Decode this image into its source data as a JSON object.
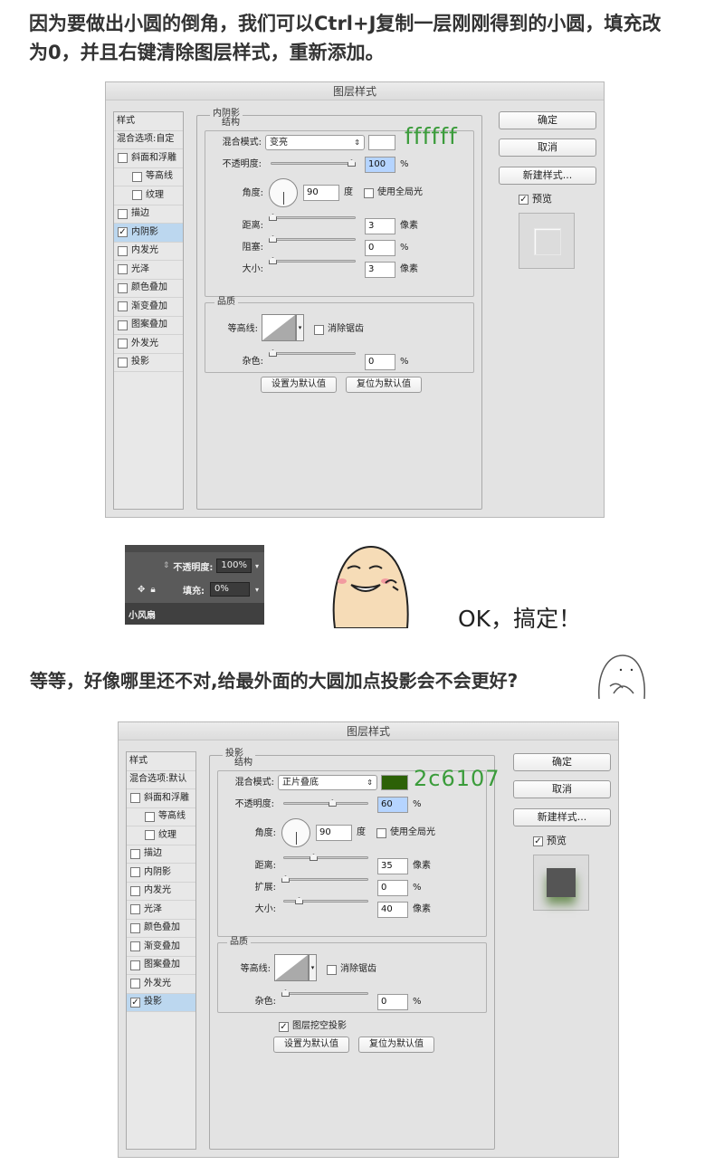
{
  "intro": {
    "line1": "因为要做出小圆的倒角，我们可以Ctrl+J复制一层刚刚得到的小圆，填充改",
    "line2": "为0，并且右键清除图层样式，重新添加。"
  },
  "dialog1": {
    "title": "图层样式",
    "sidebar": {
      "style_header": "样式",
      "blend_options": "混合选项:自定",
      "items": [
        {
          "label": "斜面和浮雕",
          "checked": false,
          "indent": false,
          "active": false
        },
        {
          "label": "等高线",
          "checked": false,
          "indent": true,
          "active": false
        },
        {
          "label": "纹理",
          "checked": false,
          "indent": true,
          "active": false
        },
        {
          "label": "描边",
          "checked": false,
          "indent": false,
          "active": false
        },
        {
          "label": "内阴影",
          "checked": true,
          "indent": false,
          "active": true
        },
        {
          "label": "内发光",
          "checked": false,
          "indent": false,
          "active": false
        },
        {
          "label": "光泽",
          "checked": false,
          "indent": false,
          "active": false
        },
        {
          "label": "颜色叠加",
          "checked": false,
          "indent": false,
          "active": false
        },
        {
          "label": "渐变叠加",
          "checked": false,
          "indent": false,
          "active": false
        },
        {
          "label": "图案叠加",
          "checked": false,
          "indent": false,
          "active": false
        },
        {
          "label": "外发光",
          "checked": false,
          "indent": false,
          "active": false
        },
        {
          "label": "投影",
          "checked": false,
          "indent": false,
          "active": false
        }
      ]
    },
    "section_title": "内阴影",
    "structure_label": "结构",
    "blend_mode_label": "混合模式:",
    "blend_mode_value": "变亮",
    "color_swatch": "#ffffff",
    "color_note": "ffffff",
    "opacity_label": "不透明度:",
    "opacity_value": "100",
    "opacity_pct": 1.0,
    "percent": "%",
    "angle_label": "角度:",
    "angle_value": "90",
    "degree": "度",
    "global_light_label": "使用全局光",
    "distance_label": "距离:",
    "distance_value": "3",
    "choke_label": "阻塞:",
    "choke_value": "0",
    "size_label": "大小:",
    "size_value": "3",
    "pixels": "像素",
    "quality_label": "品质",
    "contour_label": "等高线:",
    "antialias_label": "消除锯齿",
    "noise_label": "杂色:",
    "noise_value": "0",
    "default_btn": "设置为默认值",
    "reset_btn": "复位为默认值",
    "ok_btn": "确定",
    "cancel_btn": "取消",
    "new_style_btn": "新建样式...",
    "preview_label": "预览",
    "preview_checked": true
  },
  "layer_panel": {
    "opacity_label": "不透明度:",
    "opacity_value": "100%",
    "fill_label": "填充:",
    "fill_value": "0%",
    "layer_name": "小风扇"
  },
  "ok_text": "OK，搞定！",
  "question": "等等，好像哪里还不对,给最外面的大圆加点投影会不会更好?",
  "dialog2": {
    "title": "图层样式",
    "sidebar": {
      "style_header": "样式",
      "blend_options": "混合选项:默认",
      "items": [
        {
          "label": "斜面和浮雕",
          "checked": false,
          "indent": false,
          "active": false
        },
        {
          "label": "等高线",
          "checked": false,
          "indent": true,
          "active": false
        },
        {
          "label": "纹理",
          "checked": false,
          "indent": true,
          "active": false
        },
        {
          "label": "描边",
          "checked": false,
          "indent": false,
          "active": false
        },
        {
          "label": "内阴影",
          "checked": false,
          "indent": false,
          "active": false
        },
        {
          "label": "内发光",
          "checked": false,
          "indent": false,
          "active": false
        },
        {
          "label": "光泽",
          "checked": false,
          "indent": false,
          "active": false
        },
        {
          "label": "颜色叠加",
          "checked": false,
          "indent": false,
          "active": false
        },
        {
          "label": "渐变叠加",
          "checked": false,
          "indent": false,
          "active": false
        },
        {
          "label": "图案叠加",
          "checked": false,
          "indent": false,
          "active": false
        },
        {
          "label": "外发光",
          "checked": false,
          "indent": false,
          "active": false
        },
        {
          "label": "投影",
          "checked": true,
          "indent": false,
          "active": true
        }
      ]
    },
    "section_title": "投影",
    "structure_label": "结构",
    "blend_mode_label": "混合模式:",
    "blend_mode_value": "正片叠底",
    "color_swatch": "#2c6107",
    "color_note": "2c6107",
    "opacity_label": "不透明度:",
    "opacity_value": "60",
    "opacity_pct": 0.6,
    "percent": "%",
    "angle_label": "角度:",
    "angle_value": "90",
    "degree": "度",
    "global_light_label": "使用全局光",
    "distance_label": "距离:",
    "distance_value": "35",
    "spread_label": "扩展:",
    "spread_value": "0",
    "size_label": "大小:",
    "size_value": "40",
    "pixels": "像素",
    "quality_label": "品质",
    "contour_label": "等高线:",
    "antialias_label": "消除锯齿",
    "noise_label": "杂色:",
    "noise_value": "0",
    "knockout_label": "图层挖空投影",
    "knockout_checked": true,
    "default_btn": "设置为默认值",
    "reset_btn": "复位为默认值",
    "ok_btn": "确定",
    "cancel_btn": "取消",
    "new_style_btn": "新建样式...",
    "preview_label": "预览",
    "preview_checked": true
  }
}
